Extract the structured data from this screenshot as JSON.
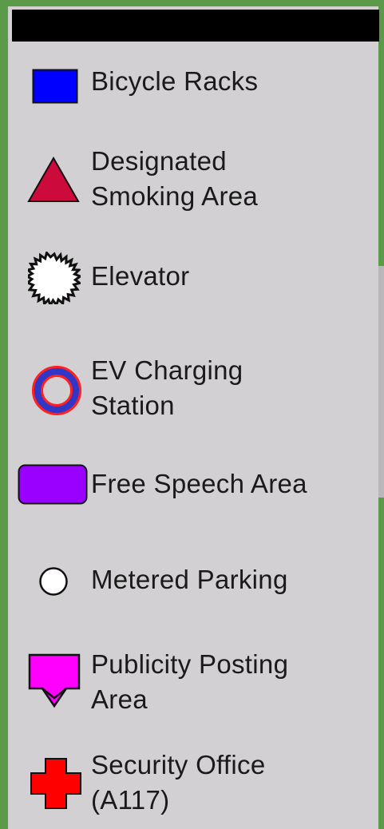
{
  "legend": {
    "items": [
      {
        "label_lines": [
          "Bicycle Racks"
        ],
        "icon": "blue-square-icon",
        "color": "#0000ff"
      },
      {
        "label_lines": [
          "Designated",
          "Smoking Area"
        ],
        "icon": "red-triangle-icon",
        "color": "#cc0a3c"
      },
      {
        "label_lines": [
          "Elevator"
        ],
        "icon": "starburst-icon",
        "color": "#ffffff"
      },
      {
        "label_lines": [
          "EV Charging",
          "Station"
        ],
        "icon": "ring-icon",
        "color": "#3036c8"
      },
      {
        "label_lines": [
          "Free Speech Area"
        ],
        "icon": "purple-rounded-rect-icon",
        "color": "#9a00ff"
      },
      {
        "label_lines": [
          "Metered Parking"
        ],
        "icon": "white-circle-icon",
        "color": "#ffffff"
      },
      {
        "label_lines": [
          "Publicity Posting",
          "Area"
        ],
        "icon": "magenta-flag-arrow-icon",
        "color": "#ff00ff"
      },
      {
        "label_lines": [
          "Security Office",
          "(A117)"
        ],
        "icon": "red-cross-icon",
        "color": "#ff0000"
      }
    ]
  }
}
